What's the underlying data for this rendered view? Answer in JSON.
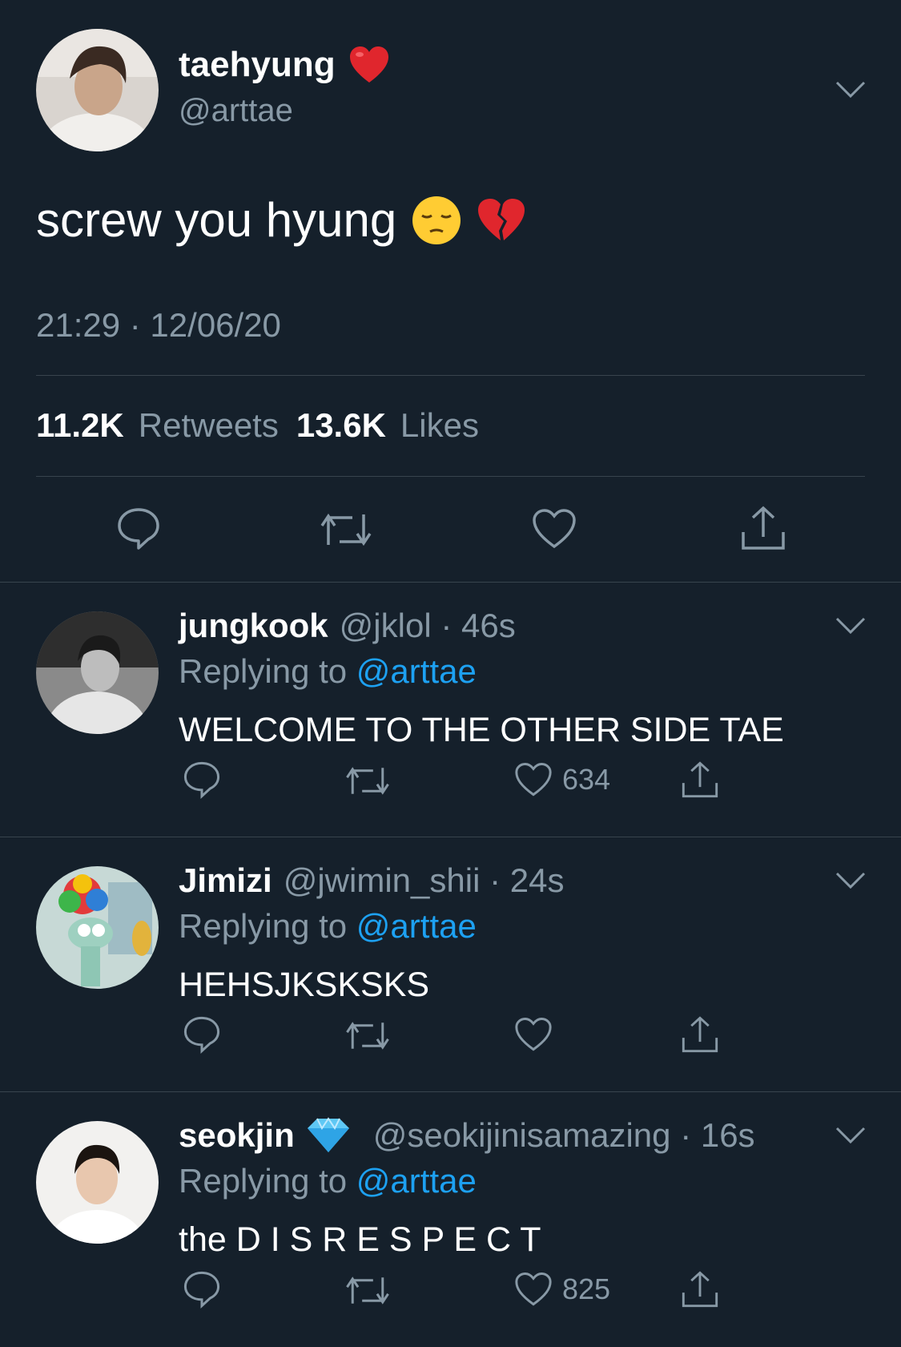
{
  "main_tweet": {
    "display_name": "taehyung",
    "name_emoji": "❤️",
    "handle": "@arttae",
    "text": "screw you hyung",
    "text_emoji": "😔 💔",
    "timestamp": "21:29 · 12/06/20",
    "retweets_count": "11.2K",
    "retweets_label": "Retweets",
    "likes_count": "13.6K",
    "likes_label": "Likes"
  },
  "replies": [
    {
      "display_name": "jungkook",
      "handle_time": "@jklol · 46s",
      "replying_prefix": "Replying to",
      "replying_mention": "@arttae",
      "text": "WELCOME TO THE OTHER SIDE TAE",
      "like_count": "634"
    },
    {
      "display_name": "Jimizi",
      "handle_time": "@jwimin_shii · 24s",
      "replying_prefix": "Replying to",
      "replying_mention": "@arttae",
      "text": "HEHSJKSKSKS",
      "like_count": ""
    },
    {
      "display_name": "seokjin",
      "name_emoji": "💎",
      "handle_time": "@seokijinisamazing · 16s",
      "replying_prefix": "Replying to",
      "replying_mention": "@arttae",
      "text": "the D I S R E S P E C T",
      "like_count": "825"
    }
  ],
  "colors": {
    "background": "#15202b",
    "secondary_text": "#8899a6",
    "link": "#1da1f2",
    "divider": "#38444d"
  },
  "icons": [
    "reply-icon",
    "retweet-icon",
    "like-icon",
    "share-icon",
    "chevron-down-icon"
  ]
}
